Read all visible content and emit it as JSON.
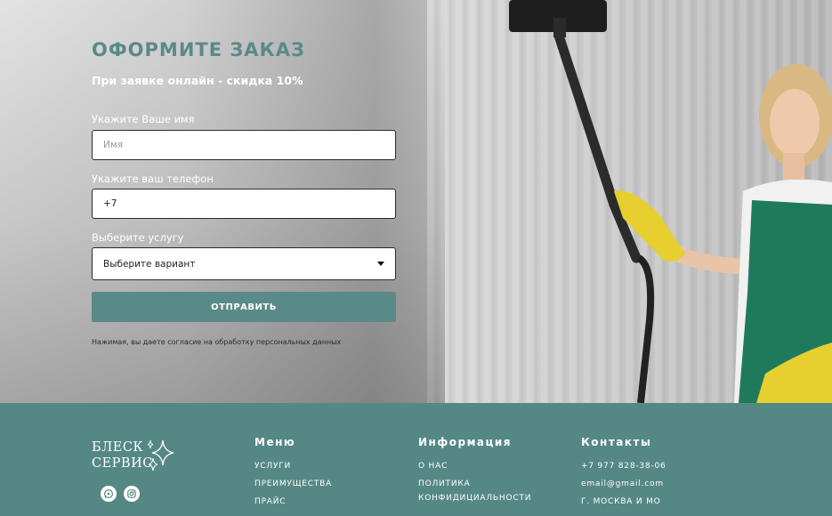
{
  "order": {
    "title": "ОФОРМИТЕ ЗАКАЗ",
    "subtitle": "При заявке онлайн - скидка 10%",
    "name_label": "Укажите Ваше имя",
    "name_placeholder": "Имя",
    "phone_label": "Укажите ваш телефон",
    "phone_value": "+7",
    "service_label": "Выберите услугу",
    "service_selected": "Выберите вариант",
    "submit_label": "ОТПРАВИТЬ",
    "consent_text": "Нажимая, вы даете согласие на обработку персональных данных"
  },
  "footer": {
    "logo_line1": "БЛЕСК",
    "logo_line2": "СЕРВИС",
    "menu": {
      "title": "Меню",
      "items": [
        "УСЛУГИ",
        "ПРЕИМУЩЕСТВА",
        "ПРАЙС"
      ]
    },
    "info": {
      "title": "Информация",
      "items": [
        "О НАС",
        "ПОЛИТИКА",
        "КОНФИДИЦИАЛЬНОСТИ"
      ]
    },
    "contacts": {
      "title": "Контакты",
      "items": [
        "+7 977 828-38-06",
        "email@gmail.com",
        "Г. МОСКВА И МО"
      ]
    },
    "social_icons": [
      "whatsapp-icon",
      "instagram-icon"
    ]
  },
  "colors": {
    "accent": "#5a8a87",
    "footer_bg": "#558884"
  }
}
